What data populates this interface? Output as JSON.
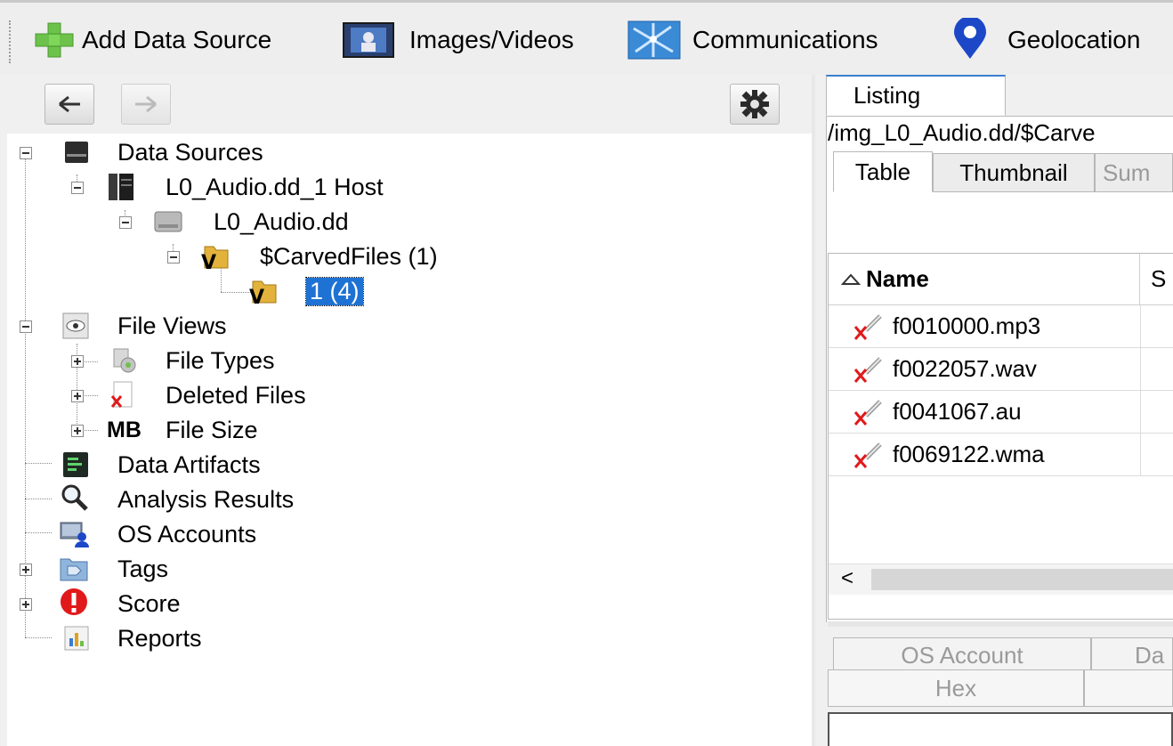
{
  "toolbar": {
    "add_data_source": "Add Data Source",
    "images_videos": "Images/Videos",
    "communications": "Communications",
    "geolocation": "Geolocation"
  },
  "tree": {
    "data_sources": "Data Sources",
    "host": "L0_Audio.dd_1 Host",
    "image": "L0_Audio.dd",
    "carved": "$CarvedFiles (1)",
    "carved_child": "1 (4)",
    "file_views": "File Views",
    "file_types": "File Types",
    "deleted_files": "Deleted Files",
    "file_size_badge": "MB",
    "file_size": "File Size",
    "data_artifacts": "Data Artifacts",
    "analysis_results": "Analysis Results",
    "os_accounts": "OS Accounts",
    "tags": "Tags",
    "score": "Score",
    "reports": "Reports"
  },
  "right": {
    "listing_tab": "Listing",
    "path": "/img_L0_Audio.dd/$Carve",
    "view_tabs": [
      "Table",
      "Thumbnail",
      "Sum"
    ],
    "columns": [
      "Name",
      "S"
    ],
    "rows": [
      "f0010000.mp3",
      "f0022057.wav",
      "f0041067.au",
      "f0069122.wma"
    ],
    "scroll_left": "<",
    "bottom_tabs_row1": [
      "OS Account",
      "Da"
    ],
    "bottom_tabs_row2": [
      "Hex",
      ""
    ]
  },
  "colors": {
    "selection": "#1e72d4",
    "score_red": "#e0191b",
    "geolocation_pin": "#1c48c8",
    "add_green": "#6cc24a"
  }
}
